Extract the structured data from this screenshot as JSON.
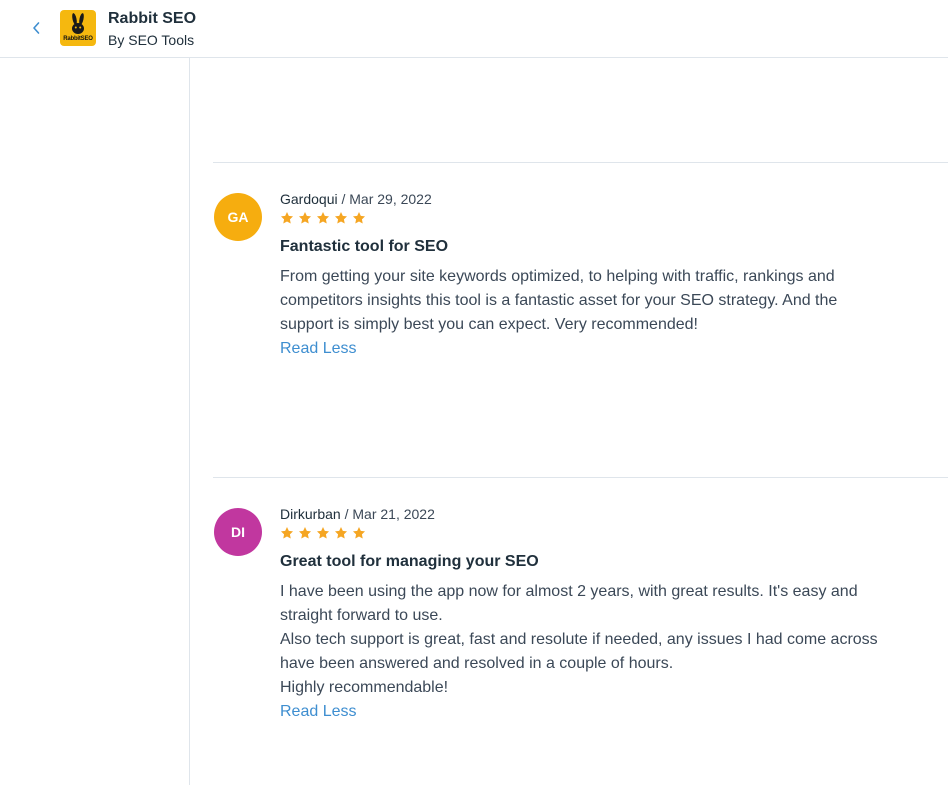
{
  "header": {
    "app_name": "Rabbit SEO",
    "vendor": "By  SEO Tools",
    "logo_text": "RabbitSEO",
    "back_icon": "chevron-left-icon"
  },
  "colors": {
    "star": "#f5a623",
    "link": "#3e8ed0",
    "avatar_ga": "#f6ad0f",
    "avatar_di": "#c1379f"
  },
  "reviews": [
    {
      "initials": "GA",
      "author": "Gardoqui",
      "date": " / Mar 29, 2022",
      "rating": 5,
      "title": "Fantastic tool for SEO",
      "paragraphs": [
        "From getting your site keywords optimized, to helping with traffic, rankings and competitors insights this tool is a fantastic asset for your SEO strategy. And the support is simply best you can expect. Very recommended!"
      ],
      "toggle_label": "Read Less"
    },
    {
      "initials": "DI",
      "author": "Dirkurban",
      "date": " / Mar 21, 2022",
      "rating": 5,
      "title": "Great tool for managing your SEO",
      "paragraphs": [
        "I have been using the app now for almost 2 years, with great results. It's easy and straight forward to use.",
        "Also tech support is great, fast and resolute if needed, any issues I had come across have been answered and resolved in a couple of hours.",
        "Highly recommendable!"
      ],
      "toggle_label": "Read Less"
    }
  ]
}
